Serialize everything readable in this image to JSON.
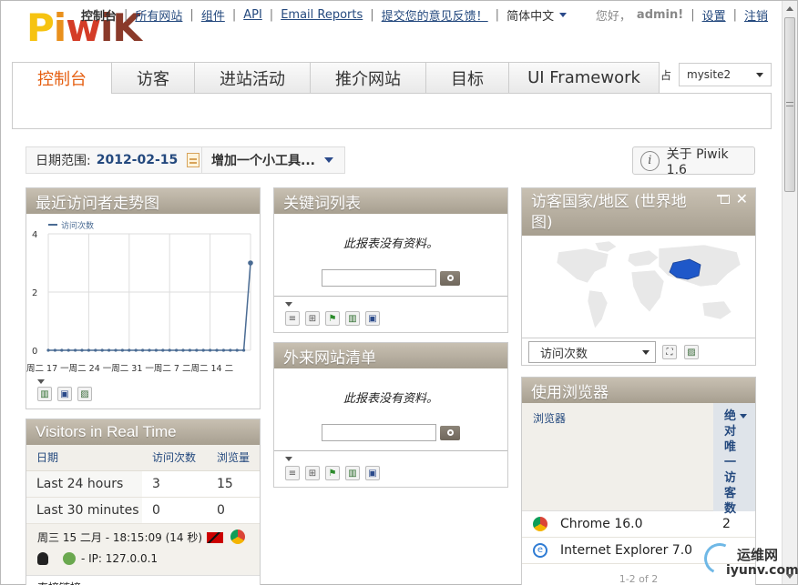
{
  "header": {
    "logo": {
      "p": "P",
      "i": "i",
      "w": "w",
      "ik": "iK"
    },
    "nav": [
      {
        "label": "控制台",
        "current": true
      },
      {
        "label": "所有网站"
      },
      {
        "label": "组件"
      },
      {
        "label": "API"
      },
      {
        "label": "Email Reports"
      },
      {
        "label": "提交您的意见反馈！"
      }
    ],
    "language": "简体中文",
    "greeting": "您好，",
    "username": "admin!",
    "settings": "设置",
    "logout": "注销"
  },
  "tabs": [
    "控制台",
    "访客",
    "进站活动",
    "推介网站",
    "目标",
    "UI Framework"
  ],
  "site_selector": {
    "value": "mysite2",
    "truncated_glyph": "占"
  },
  "toolbar": {
    "date_label": "日期范围:",
    "date_value": "2012-02-15",
    "add_widget": "增加一个小工具...",
    "about": "关于 Piwik 1.6"
  },
  "widgets": {
    "visitors_graph": {
      "title": "最近访问者走势图",
      "legend": "访问次数",
      "x_labels": "周二 17 一周二 24 一周二 31 一周二 7 二周二 14 二"
    },
    "keywords": {
      "title": "关键词列表",
      "no_data": "此报表没有资料。"
    },
    "websites": {
      "title": "外来网站清单",
      "no_data": "此报表没有资料。"
    },
    "map": {
      "title": "访客国家/地区 (世界地图)",
      "metric": "访问次数"
    },
    "realtime": {
      "title": "Visitors in Real Time",
      "headers": [
        "日期",
        "访问次数",
        "浏览量"
      ],
      "rows": [
        [
          "Last 24 hours",
          "3",
          "15"
        ],
        [
          "Last 30 minutes",
          "0",
          "0"
        ]
      ],
      "visit_time": "周三 15 二月 - 18:15:09 (14 秒)",
      "visit_ip": "- IP: 127.0.0.1",
      "referrer": "直接链接"
    },
    "browsers": {
      "title": "使用浏览器",
      "col_label": "浏览器",
      "col_metric": "绝对唯一访客数",
      "rows": [
        {
          "name": "Chrome 16.0",
          "value": "2"
        },
        {
          "name": "Internet Explorer 7.0",
          "value": ""
        }
      ],
      "pager": "1-2 of 2"
    }
  },
  "watermark": {
    "title": "运维网",
    "url": "iyunv.com"
  },
  "colors": {
    "accent": "#e55e10",
    "link": "#24497e",
    "widget_header": "#b3ab9c",
    "map_highlight": "#1f58c9"
  },
  "chart_data": {
    "type": "line",
    "title": "最近访问者走势图",
    "series": [
      {
        "name": "访问次数",
        "values": [
          0,
          0,
          0,
          0,
          0,
          0,
          0,
          0,
          0,
          0,
          0,
          0,
          0,
          0,
          0,
          0,
          0,
          0,
          0,
          0,
          0,
          0,
          0,
          0,
          0,
          0,
          0,
          0,
          0,
          0,
          3
        ]
      }
    ],
    "ylim": [
      0,
      4
    ],
    "y_ticks": [
      0,
      2,
      4
    ],
    "grid": true
  }
}
